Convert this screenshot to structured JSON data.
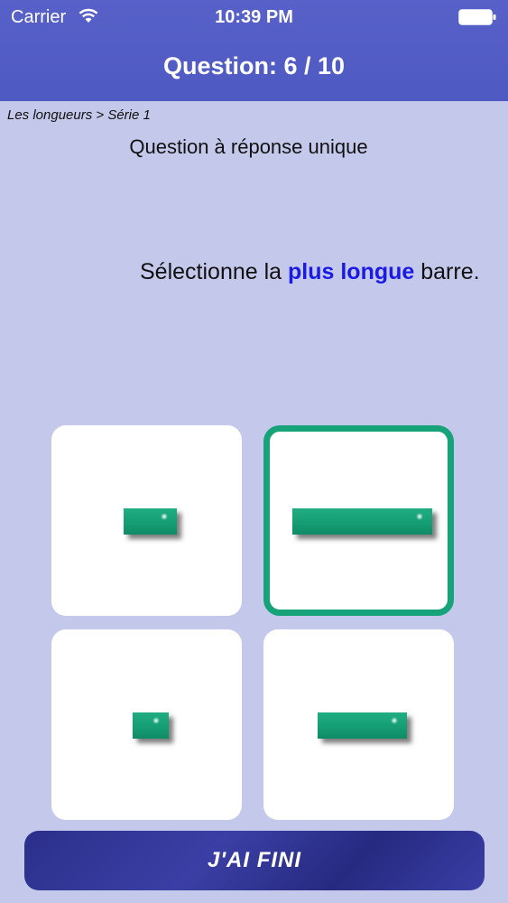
{
  "status_bar": {
    "carrier": "Carrier",
    "time": "10:39 PM",
    "wifi_icon": "wifi-icon",
    "battery_icon": "battery-icon"
  },
  "header": {
    "title": "Question: 6 / 10"
  },
  "breadcrumb": "Les longueurs > Série 1",
  "question_type": "Question à réponse unique",
  "prompt": {
    "before": "Sélectionne la ",
    "highlight": "plus longue",
    "after": " barre."
  },
  "answers": [
    {
      "id": "A",
      "bar_length_relative": 0.38,
      "selected": false
    },
    {
      "id": "B",
      "bar_length_relative": 1.0,
      "selected": true
    },
    {
      "id": "C",
      "bar_length_relative": 0.26,
      "selected": false
    },
    {
      "id": "D",
      "bar_length_relative": 0.64,
      "selected": false
    }
  ],
  "done_button": {
    "label": "J'AI FINI"
  },
  "colors": {
    "header_background": "#4e59c2",
    "page_background": "#c4c8eb",
    "bar_color": "#16a37a",
    "selection_border": "#16a37a",
    "highlight_text": "#1a1ae6",
    "button_background": "#2f338f"
  }
}
